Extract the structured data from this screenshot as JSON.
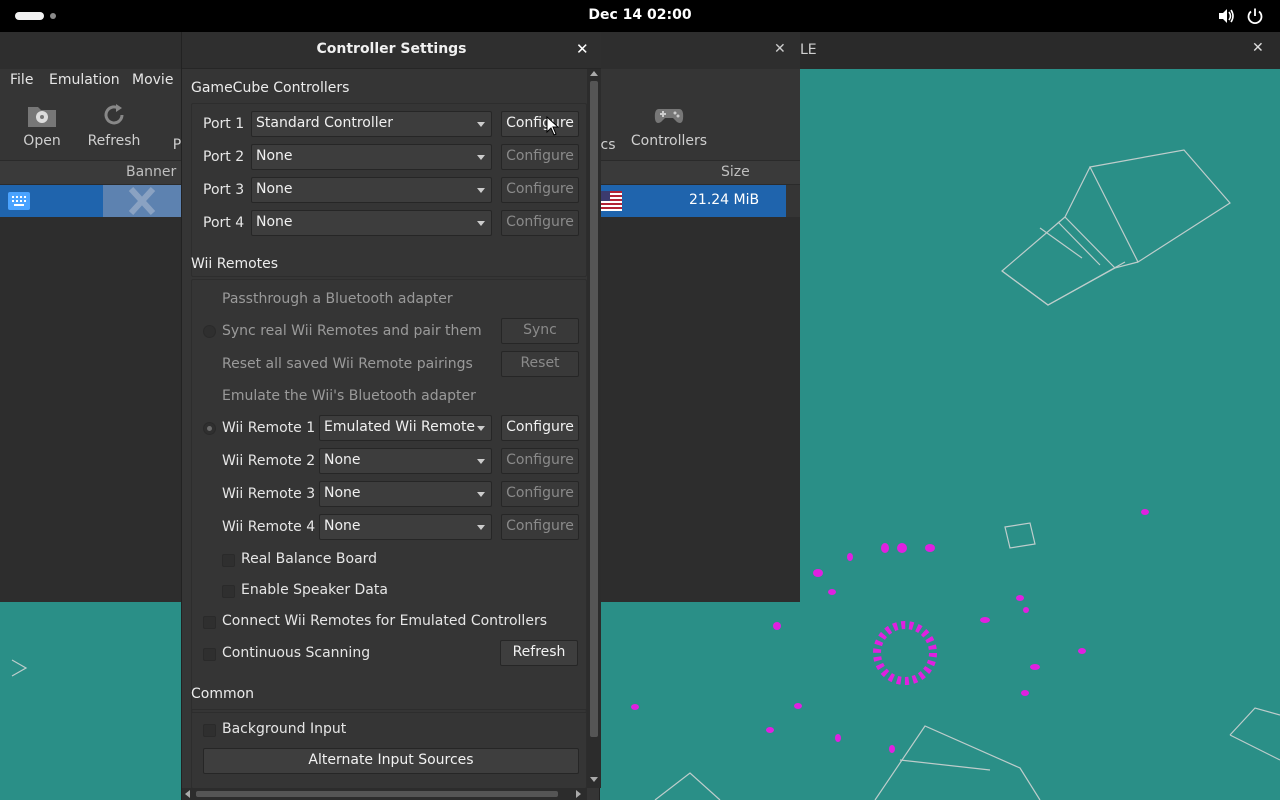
{
  "topbar": {
    "clock": "Dec 14  02:00"
  },
  "game_window": {
    "title": "LE"
  },
  "main_window": {
    "menu": [
      "File",
      "Emulation",
      "Movie"
    ],
    "toolbar": {
      "open": "Open",
      "refresh": "Refresh",
      "partial_left": "P",
      "partial_graphics": "cs",
      "controllers": "Controllers"
    },
    "columns": {
      "banner": "Banner",
      "size": "Size"
    },
    "game_row": {
      "size": "21.24 MiB"
    }
  },
  "dialog": {
    "title": "Controller Settings",
    "gamecube": {
      "title": "GameCube Controllers",
      "ports": [
        {
          "label": "Port 1",
          "value": "Standard Controller",
          "button": "Configure"
        },
        {
          "label": "Port 2",
          "value": "None",
          "button": "Configure"
        },
        {
          "label": "Port 3",
          "value": "None",
          "button": "Configure"
        },
        {
          "label": "Port 4",
          "value": "None",
          "button": "Configure"
        }
      ]
    },
    "wii": {
      "title": "Wii Remotes",
      "passthrough": "Passthrough a Bluetooth adapter",
      "sync_label": "Sync real Wii Remotes and pair them",
      "sync_button": "Sync",
      "reset_label": "Reset all saved Wii Remote pairings",
      "reset_button": "Reset",
      "emulate": "Emulate the Wii's Bluetooth adapter",
      "remotes": [
        {
          "label": "Wii Remote 1",
          "value": "Emulated Wii Remote",
          "button": "Configure"
        },
        {
          "label": "Wii Remote 2",
          "value": "None",
          "button": "Configure"
        },
        {
          "label": "Wii Remote 3",
          "value": "None",
          "button": "Configure"
        },
        {
          "label": "Wii Remote 4",
          "value": "None",
          "button": "Configure"
        }
      ],
      "balance_board": "Real Balance Board",
      "speaker_data": "Enable Speaker Data",
      "connect_emulated": "Connect Wii Remotes for Emulated Controllers",
      "continuous_scanning": "Continuous Scanning",
      "refresh_button": "Refresh"
    },
    "common": {
      "title": "Common",
      "background_input": "Background Input",
      "alternate_sources": "Alternate Input Sources"
    }
  }
}
